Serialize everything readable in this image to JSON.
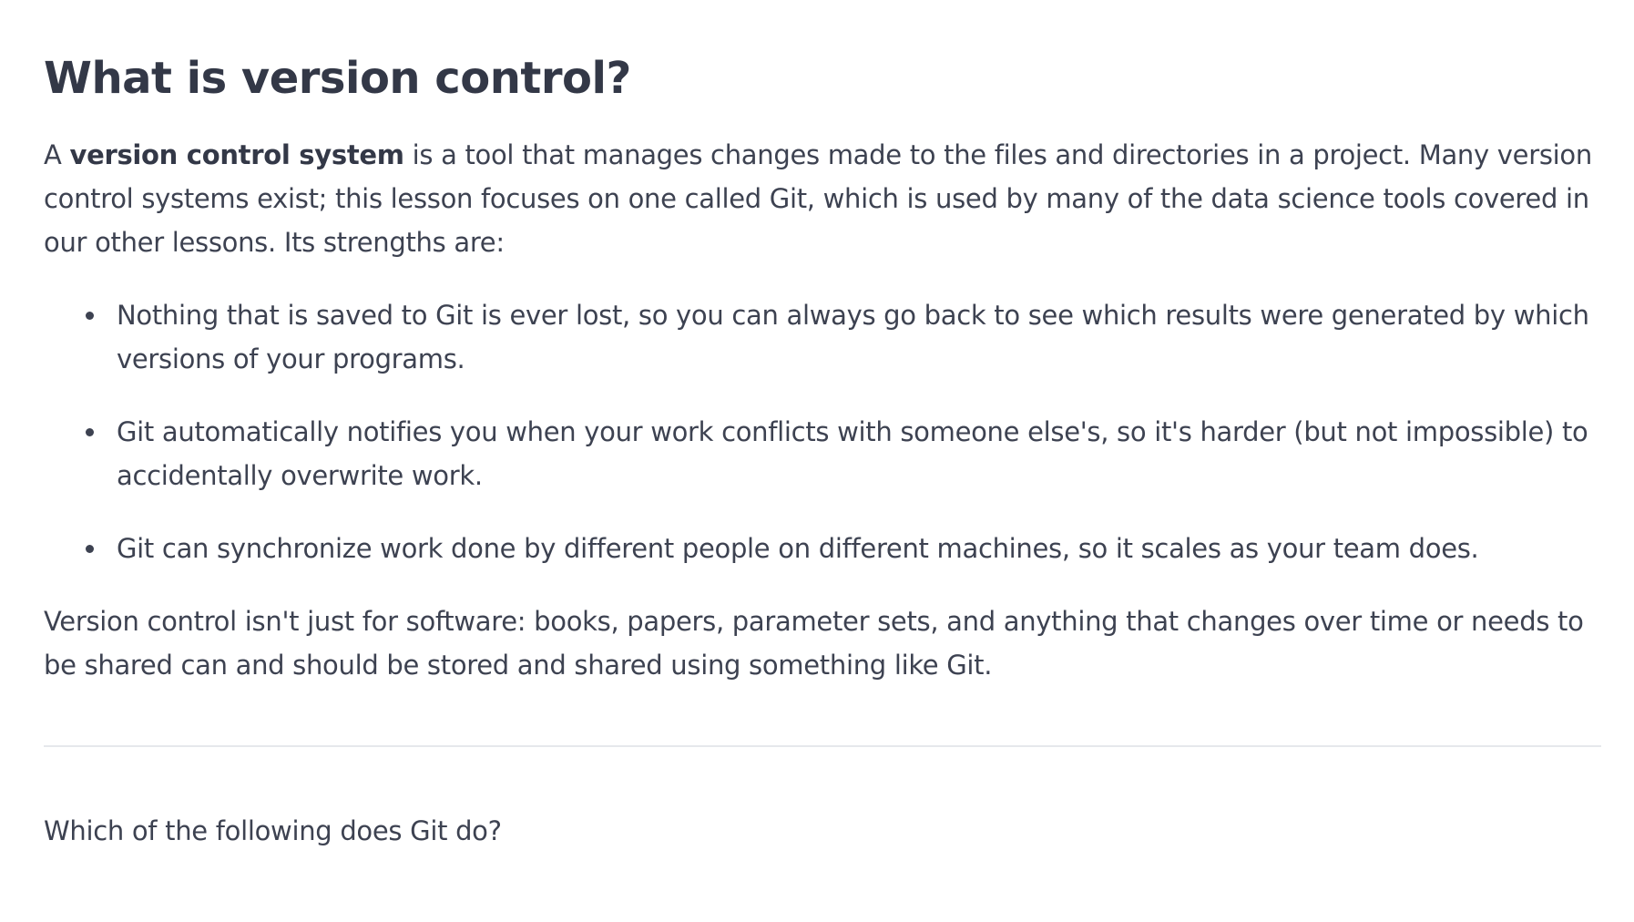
{
  "lesson": {
    "title": "What is version control?",
    "intro": {
      "prefix": "A ",
      "term": "version control system",
      "rest": " is a tool that manages changes made to the files and directories in a project. Many version control systems exist; this lesson focuses on one called Git, which is used by many of the data science tools covered in our other lessons. Its strengths are:"
    },
    "bullets": [
      "Nothing that is saved to Git is ever lost, so you can always go back to see which results were generated by which versions of your programs.",
      "Git automatically notifies you when your work conflicts with someone else's, so it's harder (but not impossible) to accidentally overwrite work.",
      "Git can synchronize work done by different people on different machines, so it scales as your team does."
    ],
    "closing": "Version control isn't just for software: books, papers, parameter sets, and anything that changes over time or needs to be shared can and should be stored and shared using something like Git."
  },
  "quiz": {
    "question": "Which of the following does Git do?"
  }
}
